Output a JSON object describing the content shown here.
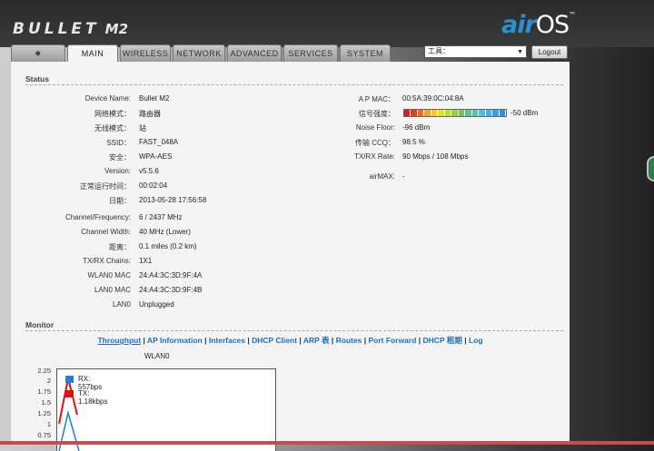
{
  "header": {
    "brand": "BULLET",
    "brand_model": "M2",
    "os_air": "air",
    "os_name": "OS",
    "os_tm": "™"
  },
  "tabs": [
    {
      "label": "🞸",
      "name": "tab-logo"
    },
    {
      "label": "MAIN",
      "name": "tab-main"
    },
    {
      "label": "WIRELESS",
      "name": "tab-wireless"
    },
    {
      "label": "NETWORK",
      "name": "tab-network"
    },
    {
      "label": "ADVANCED",
      "name": "tab-advanced"
    },
    {
      "label": "SERVICES",
      "name": "tab-services"
    },
    {
      "label": "SYSTEM",
      "name": "tab-system"
    }
  ],
  "toolbar": {
    "tools_selected": "工具：",
    "logout_label": "Logout"
  },
  "status": {
    "title": "Status",
    "left": [
      {
        "label": "Device Name:",
        "value": "Bullet M2"
      },
      {
        "label": "网络模式：",
        "value": "路由器"
      },
      {
        "label": "无线模式：",
        "value": "站"
      },
      {
        "label": "SSID：",
        "value": "FAST_048A"
      },
      {
        "label": "安全：",
        "value": "WPA-AES"
      },
      {
        "label": "Version:",
        "value": "v5.5.6"
      },
      {
        "label": "正常运行时间：",
        "value": "00:02:04"
      },
      {
        "label": "日期：",
        "value": "2013-05-28 17:56:58"
      },
      {
        "label": "Channel/Frequency:",
        "value": "6 / 2437 MHz"
      },
      {
        "label": "Channel Width:",
        "value": "40 MHz (Lower)"
      },
      {
        "label": "距离：",
        "value": "0.1 miles (0.2 km)"
      },
      {
        "label": "TX/RX Chains:",
        "value": "1X1"
      },
      {
        "label": "WLAN0 MAC",
        "value": "24:A4:3C:3D:9F:4A"
      },
      {
        "label": "LAN0 MAC",
        "value": "24:A4:3C:3D:9F:4B"
      },
      {
        "label": "LAN0",
        "value": "Unplugged"
      }
    ],
    "right": [
      {
        "label": "A P MAC：",
        "value": "00:5A:39:0C:04:8A"
      },
      {
        "label": "信号强度：",
        "value": "-50 dBm"
      },
      {
        "label": "Noise Floor:",
        "value": "-96 dBm"
      },
      {
        "label": "传输 CCQ：",
        "value": "98.5 %"
      },
      {
        "label": "TX/RX Rate:",
        "value": "90 Mbps / 108 Mbps"
      },
      {
        "label": "airMAX:",
        "value": "-"
      }
    ],
    "signal_colors": [
      "#d62020",
      "#e23b1d",
      "#ee6e1c",
      "#f7a31d",
      "#f9c81e",
      "#e8df1f",
      "#c2dc2a",
      "#95d040",
      "#6cc85a",
      "#5ec488",
      "#55c3b0",
      "#4fbfd6",
      "#46b2e6",
      "#3aa0e6",
      "#2f8ede"
    ]
  },
  "monitor": {
    "title": "Monitor",
    "links": [
      "Throughput",
      "AP Information",
      "Interfaces",
      "DHCP Client",
      "ARP 表",
      "Routes",
      "Port Forward",
      "DHCP 租期",
      "Log"
    ]
  },
  "chart_data": {
    "type": "line",
    "title": "WLAN0",
    "yticks": [
      "2.25",
      "2",
      "1.75",
      "1.5",
      "1.25",
      "1",
      "0.75"
    ],
    "series": [
      {
        "name": "RX: 557bps",
        "color": "#1f7fd0"
      },
      {
        "name": "TX: 1.18kbps",
        "color": "#e01010"
      }
    ]
  }
}
